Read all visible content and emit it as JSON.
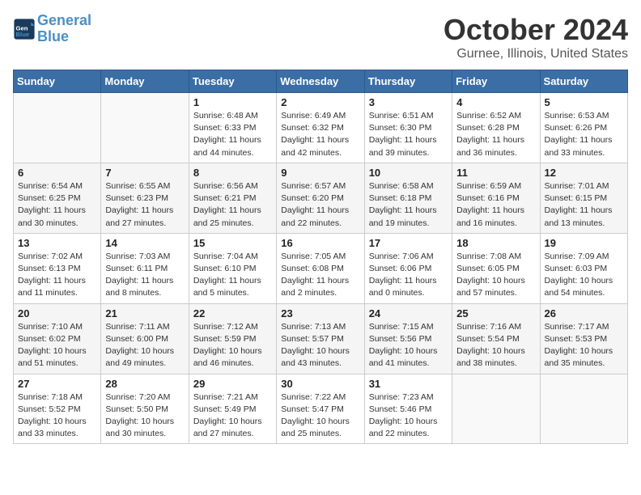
{
  "logo": {
    "line1": "General",
    "line2": "Blue"
  },
  "title": "October 2024",
  "location": "Gurnee, Illinois, United States",
  "weekdays": [
    "Sunday",
    "Monday",
    "Tuesday",
    "Wednesday",
    "Thursday",
    "Friday",
    "Saturday"
  ],
  "weeks": [
    [
      {
        "day": "",
        "sunrise": "",
        "sunset": "",
        "daylight": ""
      },
      {
        "day": "",
        "sunrise": "",
        "sunset": "",
        "daylight": ""
      },
      {
        "day": "1",
        "sunrise": "Sunrise: 6:48 AM",
        "sunset": "Sunset: 6:33 PM",
        "daylight": "Daylight: 11 hours and 44 minutes."
      },
      {
        "day": "2",
        "sunrise": "Sunrise: 6:49 AM",
        "sunset": "Sunset: 6:32 PM",
        "daylight": "Daylight: 11 hours and 42 minutes."
      },
      {
        "day": "3",
        "sunrise": "Sunrise: 6:51 AM",
        "sunset": "Sunset: 6:30 PM",
        "daylight": "Daylight: 11 hours and 39 minutes."
      },
      {
        "day": "4",
        "sunrise": "Sunrise: 6:52 AM",
        "sunset": "Sunset: 6:28 PM",
        "daylight": "Daylight: 11 hours and 36 minutes."
      },
      {
        "day": "5",
        "sunrise": "Sunrise: 6:53 AM",
        "sunset": "Sunset: 6:26 PM",
        "daylight": "Daylight: 11 hours and 33 minutes."
      }
    ],
    [
      {
        "day": "6",
        "sunrise": "Sunrise: 6:54 AM",
        "sunset": "Sunset: 6:25 PM",
        "daylight": "Daylight: 11 hours and 30 minutes."
      },
      {
        "day": "7",
        "sunrise": "Sunrise: 6:55 AM",
        "sunset": "Sunset: 6:23 PM",
        "daylight": "Daylight: 11 hours and 27 minutes."
      },
      {
        "day": "8",
        "sunrise": "Sunrise: 6:56 AM",
        "sunset": "Sunset: 6:21 PM",
        "daylight": "Daylight: 11 hours and 25 minutes."
      },
      {
        "day": "9",
        "sunrise": "Sunrise: 6:57 AM",
        "sunset": "Sunset: 6:20 PM",
        "daylight": "Daylight: 11 hours and 22 minutes."
      },
      {
        "day": "10",
        "sunrise": "Sunrise: 6:58 AM",
        "sunset": "Sunset: 6:18 PM",
        "daylight": "Daylight: 11 hours and 19 minutes."
      },
      {
        "day": "11",
        "sunrise": "Sunrise: 6:59 AM",
        "sunset": "Sunset: 6:16 PM",
        "daylight": "Daylight: 11 hours and 16 minutes."
      },
      {
        "day": "12",
        "sunrise": "Sunrise: 7:01 AM",
        "sunset": "Sunset: 6:15 PM",
        "daylight": "Daylight: 11 hours and 13 minutes."
      }
    ],
    [
      {
        "day": "13",
        "sunrise": "Sunrise: 7:02 AM",
        "sunset": "Sunset: 6:13 PM",
        "daylight": "Daylight: 11 hours and 11 minutes."
      },
      {
        "day": "14",
        "sunrise": "Sunrise: 7:03 AM",
        "sunset": "Sunset: 6:11 PM",
        "daylight": "Daylight: 11 hours and 8 minutes."
      },
      {
        "day": "15",
        "sunrise": "Sunrise: 7:04 AM",
        "sunset": "Sunset: 6:10 PM",
        "daylight": "Daylight: 11 hours and 5 minutes."
      },
      {
        "day": "16",
        "sunrise": "Sunrise: 7:05 AM",
        "sunset": "Sunset: 6:08 PM",
        "daylight": "Daylight: 11 hours and 2 minutes."
      },
      {
        "day": "17",
        "sunrise": "Sunrise: 7:06 AM",
        "sunset": "Sunset: 6:06 PM",
        "daylight": "Daylight: 11 hours and 0 minutes."
      },
      {
        "day": "18",
        "sunrise": "Sunrise: 7:08 AM",
        "sunset": "Sunset: 6:05 PM",
        "daylight": "Daylight: 10 hours and 57 minutes."
      },
      {
        "day": "19",
        "sunrise": "Sunrise: 7:09 AM",
        "sunset": "Sunset: 6:03 PM",
        "daylight": "Daylight: 10 hours and 54 minutes."
      }
    ],
    [
      {
        "day": "20",
        "sunrise": "Sunrise: 7:10 AM",
        "sunset": "Sunset: 6:02 PM",
        "daylight": "Daylight: 10 hours and 51 minutes."
      },
      {
        "day": "21",
        "sunrise": "Sunrise: 7:11 AM",
        "sunset": "Sunset: 6:00 PM",
        "daylight": "Daylight: 10 hours and 49 minutes."
      },
      {
        "day": "22",
        "sunrise": "Sunrise: 7:12 AM",
        "sunset": "Sunset: 5:59 PM",
        "daylight": "Daylight: 10 hours and 46 minutes."
      },
      {
        "day": "23",
        "sunrise": "Sunrise: 7:13 AM",
        "sunset": "Sunset: 5:57 PM",
        "daylight": "Daylight: 10 hours and 43 minutes."
      },
      {
        "day": "24",
        "sunrise": "Sunrise: 7:15 AM",
        "sunset": "Sunset: 5:56 PM",
        "daylight": "Daylight: 10 hours and 41 minutes."
      },
      {
        "day": "25",
        "sunrise": "Sunrise: 7:16 AM",
        "sunset": "Sunset: 5:54 PM",
        "daylight": "Daylight: 10 hours and 38 minutes."
      },
      {
        "day": "26",
        "sunrise": "Sunrise: 7:17 AM",
        "sunset": "Sunset: 5:53 PM",
        "daylight": "Daylight: 10 hours and 35 minutes."
      }
    ],
    [
      {
        "day": "27",
        "sunrise": "Sunrise: 7:18 AM",
        "sunset": "Sunset: 5:52 PM",
        "daylight": "Daylight: 10 hours and 33 minutes."
      },
      {
        "day": "28",
        "sunrise": "Sunrise: 7:20 AM",
        "sunset": "Sunset: 5:50 PM",
        "daylight": "Daylight: 10 hours and 30 minutes."
      },
      {
        "day": "29",
        "sunrise": "Sunrise: 7:21 AM",
        "sunset": "Sunset: 5:49 PM",
        "daylight": "Daylight: 10 hours and 27 minutes."
      },
      {
        "day": "30",
        "sunrise": "Sunrise: 7:22 AM",
        "sunset": "Sunset: 5:47 PM",
        "daylight": "Daylight: 10 hours and 25 minutes."
      },
      {
        "day": "31",
        "sunrise": "Sunrise: 7:23 AM",
        "sunset": "Sunset: 5:46 PM",
        "daylight": "Daylight: 10 hours and 22 minutes."
      },
      {
        "day": "",
        "sunrise": "",
        "sunset": "",
        "daylight": ""
      },
      {
        "day": "",
        "sunrise": "",
        "sunset": "",
        "daylight": ""
      }
    ]
  ]
}
